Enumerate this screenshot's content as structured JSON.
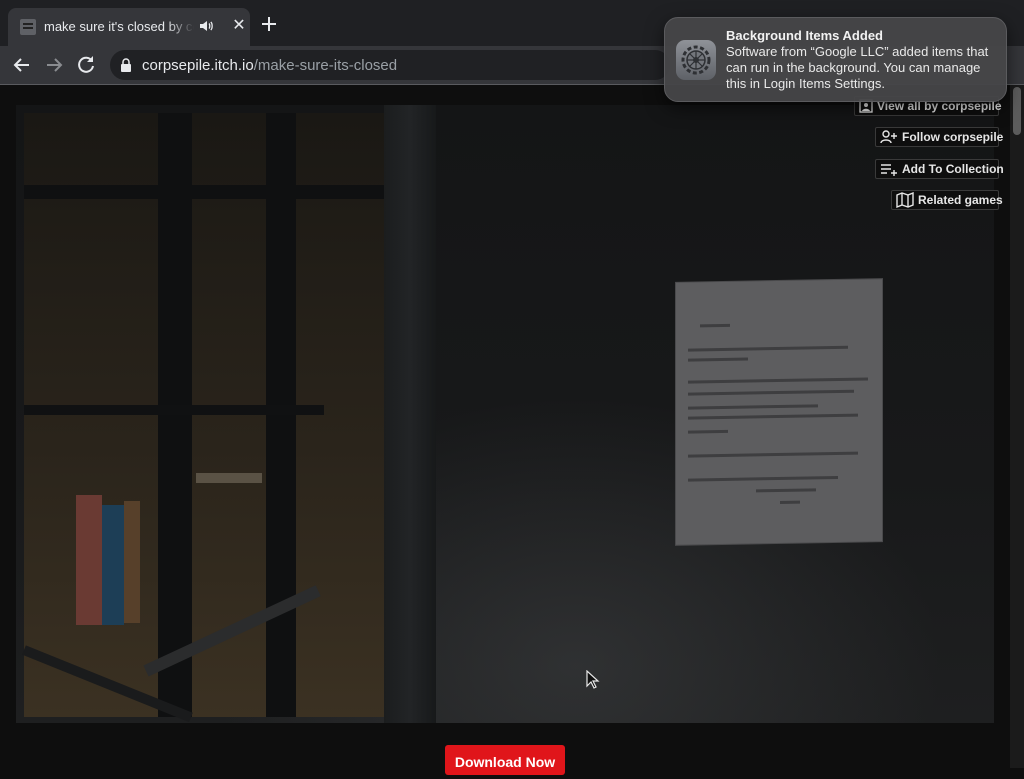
{
  "tab": {
    "title": "make sure it's closed by corpsepile",
    "close_glyph": "✕"
  },
  "toolbar": {
    "url_host": "corpsepile.itch.io",
    "url_path": "/make-sure-its-closed"
  },
  "notification": {
    "title": "Background Items Added",
    "body": "Software from “Google LLC” added items that can run in the background. You can manage this in Login Items Settings."
  },
  "side_buttons": {
    "view_all": "View all by corpsepile",
    "follow": "Follow corpsepile",
    "add_collection": "Add To Collection",
    "related": "Related games"
  },
  "download": {
    "label": "Download Now"
  },
  "colors": {
    "download_red": "#e0151a",
    "chrome_dark": "#202124",
    "chrome_toolbar": "#35363a"
  },
  "icons": [
    "speaker-icon",
    "close-icon",
    "plus-icon",
    "back-arrow-icon",
    "forward-arrow-icon",
    "reload-icon",
    "lock-icon",
    "settings-gear-icon",
    "user-icon",
    "person-plus-icon",
    "playlist-add-icon",
    "map-icon",
    "mouse-pointer-icon"
  ]
}
